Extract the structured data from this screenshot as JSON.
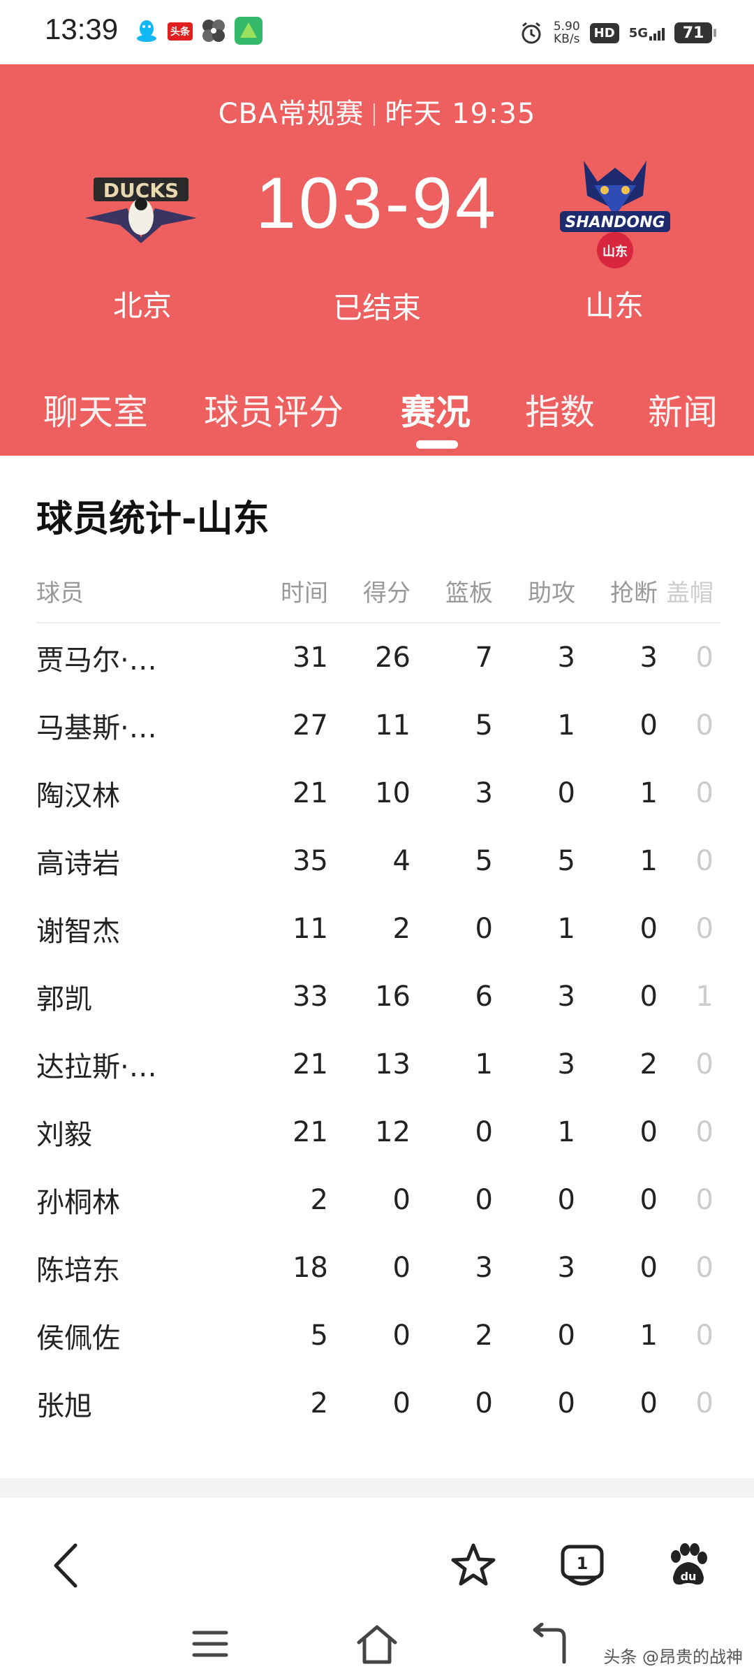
{
  "status_bar": {
    "time": "13:39",
    "net_speed_value": "5.90",
    "net_speed_unit": "KB/s",
    "hd": "HD",
    "network": "5G",
    "battery": "71",
    "app_icons": [
      "qq-icon",
      "toutiao-icon",
      "pinwheel-icon",
      "app-icon"
    ],
    "toutiao_label": "头条"
  },
  "game": {
    "league": "CBA常规赛",
    "time": "昨天 19:35",
    "score": "103-94",
    "status": "已结束",
    "home": {
      "name": "北京",
      "logo_text": "DUCKS"
    },
    "away": {
      "name": "山东",
      "logo_text": "SHANDONG",
      "logo_sub": "山东"
    }
  },
  "tabs": [
    {
      "label": "聊天室",
      "active": false
    },
    {
      "label": "球员评分",
      "active": false
    },
    {
      "label": "赛况",
      "active": true
    },
    {
      "label": "指数",
      "active": false
    },
    {
      "label": "新闻",
      "active": false
    }
  ],
  "stats": {
    "title": "球员统计-山东",
    "headers": [
      "球员",
      "时间",
      "得分",
      "篮板",
      "助攻",
      "抢断",
      "盖帽"
    ],
    "rows": [
      [
        "贾马尔·…",
        "31",
        "26",
        "7",
        "3",
        "3",
        "0"
      ],
      [
        "马基斯·…",
        "27",
        "11",
        "5",
        "1",
        "0",
        "0"
      ],
      [
        "陶汉林",
        "21",
        "10",
        "3",
        "0",
        "1",
        "0"
      ],
      [
        "高诗岩",
        "35",
        "4",
        "5",
        "5",
        "1",
        "0"
      ],
      [
        "谢智杰",
        "11",
        "2",
        "0",
        "1",
        "0",
        "0"
      ],
      [
        "郭凯",
        "33",
        "16",
        "6",
        "3",
        "0",
        "1"
      ],
      [
        "达拉斯·…",
        "21",
        "13",
        "1",
        "3",
        "2",
        "0"
      ],
      [
        "刘毅",
        "21",
        "12",
        "0",
        "1",
        "0",
        "0"
      ],
      [
        "孙桐林",
        "2",
        "0",
        "0",
        "0",
        "0",
        "0"
      ],
      [
        "陈培东",
        "18",
        "0",
        "3",
        "3",
        "0",
        "0"
      ],
      [
        "侯佩佐",
        "5",
        "0",
        "2",
        "0",
        "1",
        "0"
      ],
      [
        "张旭",
        "2",
        "0",
        "0",
        "0",
        "0",
        "0"
      ]
    ]
  },
  "browser_bar": {
    "tab_count": "1",
    "icons": [
      "back-icon",
      "star-icon",
      "tabs-icon",
      "baidu-paw-icon"
    ]
  },
  "nav_bar": {
    "icons": [
      "menu-icon",
      "home-icon",
      "return-icon"
    ],
    "watermark": "头条 @昂贵的战神"
  }
}
